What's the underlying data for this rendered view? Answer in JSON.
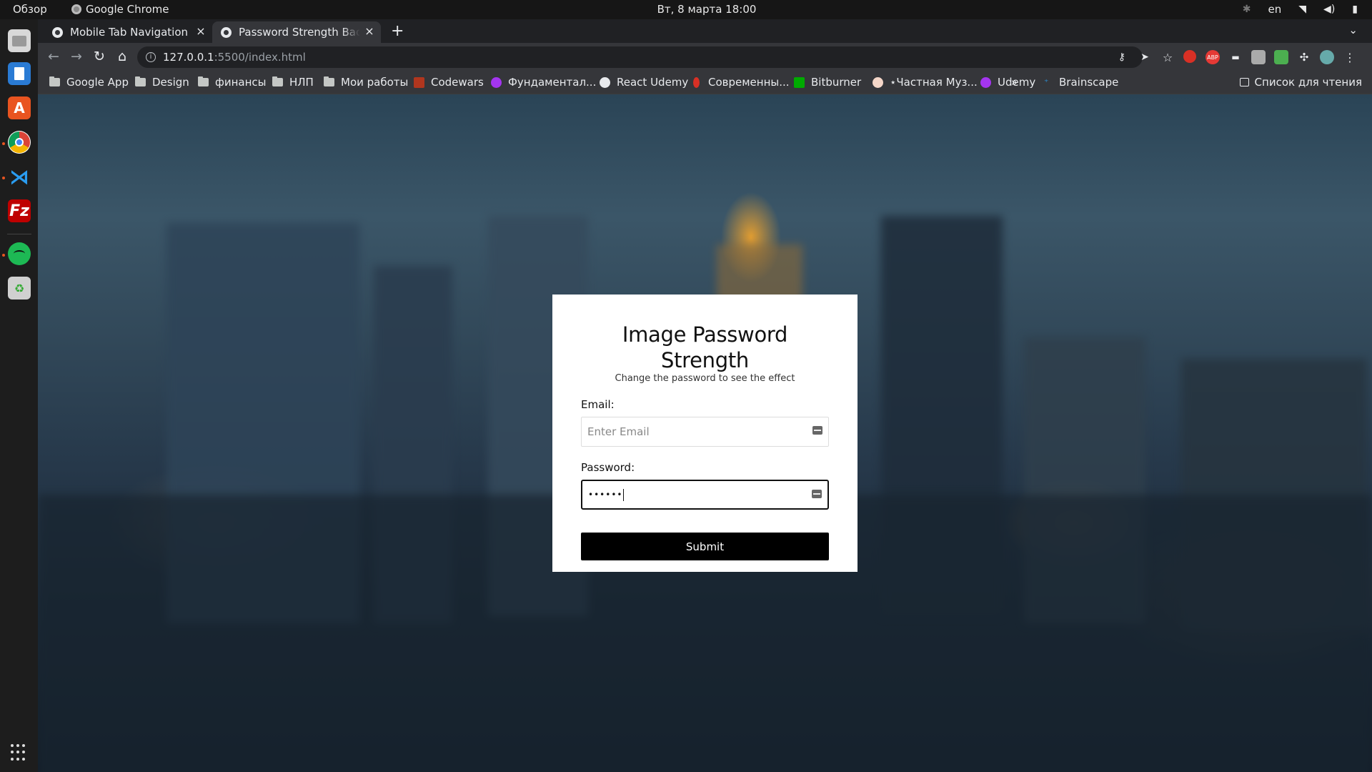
{
  "topbar": {
    "overview": "Обзор",
    "app_name": "Google Chrome",
    "clock": "Вт, 8 марта  18:00",
    "lang": "en"
  },
  "dock": {
    "apps": [
      "files",
      "libreoffice-writer",
      "software-center",
      "google-chrome",
      "vscode",
      "filezilla",
      "spotify",
      "trash"
    ]
  },
  "browser": {
    "tabs": [
      {
        "title": "Mobile Tab Navigation",
        "active": false
      },
      {
        "title": "Password Strength Background",
        "active": true
      }
    ],
    "url_host": "127.0.0.1",
    "url_path": ":5500/index.html",
    "bookmarks": [
      {
        "label": "Google App",
        "type": "folder"
      },
      {
        "label": "Design",
        "type": "folder"
      },
      {
        "label": "финансы",
        "type": "folder"
      },
      {
        "label": "НЛП",
        "type": "folder"
      },
      {
        "label": "Мои работы",
        "type": "folder"
      },
      {
        "label": "Codewars",
        "type": "site",
        "color": "#b1361e"
      },
      {
        "label": "Фундаментал...",
        "type": "site",
        "color": "#a435f0"
      },
      {
        "label": "React Udemy",
        "type": "site",
        "color": "#e8eaed"
      },
      {
        "label": "Современны...",
        "type": "site",
        "color": "#d93025"
      },
      {
        "label": "Bitburner",
        "type": "site",
        "color": "#0c0"
      },
      {
        "label": "⋆Частная Муз...",
        "type": "site",
        "color": "#f4d6c8"
      },
      {
        "label": "Udemy",
        "type": "site",
        "color": "#a435f0"
      },
      {
        "label": "Brainscape",
        "type": "site",
        "color": "#2a8dd4"
      }
    ],
    "more": "»",
    "reading_list": "Список для чтения"
  },
  "page": {
    "title": "Image Password Strength",
    "subtitle": "Change the password to see the effect",
    "email_label": "Email:",
    "email_placeholder": "Enter Email",
    "password_label": "Password:",
    "password_mask": "••••••",
    "submit_label": "Submit"
  },
  "colors": {
    "card_bg": "#ffffff",
    "button_bg": "#000000",
    "chrome_toolbar": "#35363a",
    "chrome_tabstrip": "#202124"
  }
}
